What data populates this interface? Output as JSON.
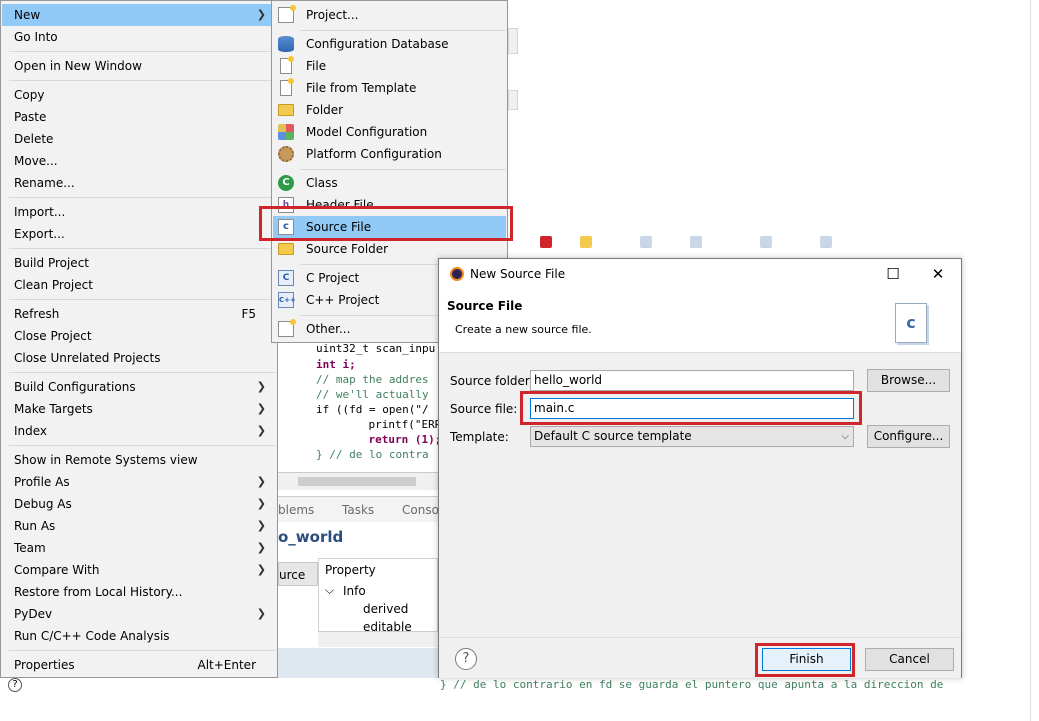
{
  "context_menu": {
    "items": [
      {
        "label": "New",
        "submenu": true,
        "highlighted": true
      },
      {
        "label": "Go Into"
      },
      {
        "label": "Open in New Window"
      },
      {
        "label": "Copy"
      },
      {
        "label": "Paste"
      },
      {
        "label": "Delete"
      },
      {
        "label": "Move..."
      },
      {
        "label": "Rename..."
      },
      {
        "label": "Import..."
      },
      {
        "label": "Export..."
      },
      {
        "label": "Build Project"
      },
      {
        "label": "Clean Project"
      },
      {
        "label": "Refresh",
        "accelerator": "F5"
      },
      {
        "label": "Close Project"
      },
      {
        "label": "Close Unrelated Projects"
      },
      {
        "label": "Build Configurations",
        "submenu": true
      },
      {
        "label": "Make Targets",
        "submenu": true
      },
      {
        "label": "Index",
        "submenu": true
      },
      {
        "label": "Show in Remote Systems view"
      },
      {
        "label": "Profile As",
        "submenu": true
      },
      {
        "label": "Debug As",
        "submenu": true
      },
      {
        "label": "Run As",
        "submenu": true
      },
      {
        "label": "Team",
        "submenu": true
      },
      {
        "label": "Compare With",
        "submenu": true
      },
      {
        "label": "Restore from Local History..."
      },
      {
        "label": "PyDev",
        "submenu": true
      },
      {
        "label": "Run C/C++ Code Analysis"
      },
      {
        "label": "Properties",
        "accelerator": "Alt+Enter"
      }
    ]
  },
  "new_submenu": {
    "items": [
      {
        "label": "Project...",
        "icon": "new-project-icon"
      },
      {
        "label": "Configuration Database",
        "icon": "database-icon"
      },
      {
        "label": "File",
        "icon": "file-icon"
      },
      {
        "label": "File from Template",
        "icon": "file-template-icon"
      },
      {
        "label": "Folder",
        "icon": "folder-icon"
      },
      {
        "label": "Model Configuration",
        "icon": "model-config-icon"
      },
      {
        "label": "Platform Configuration",
        "icon": "platform-config-icon"
      },
      {
        "label": "Class",
        "icon": "class-icon"
      },
      {
        "label": "Header File",
        "icon": "header-file-icon"
      },
      {
        "label": "Source File",
        "icon": "source-file-icon",
        "highlighted": true
      },
      {
        "label": "Source Folder",
        "icon": "source-folder-icon"
      },
      {
        "label": "C Project",
        "icon": "c-project-icon"
      },
      {
        "label": "C++ Project",
        "icon": "cpp-project-icon"
      },
      {
        "label": "Other...",
        "icon": "other-wizard-icon"
      }
    ]
  },
  "background_editor": {
    "code_lines": [
      "uint32_t scan_inpu",
      "int i;",
      "// map the addres",
      "// we'll actually",
      "if ((fd = open(\"/",
      "    printf(\"ERROR",
      "    return (1);",
      "} // de lo contra"
    ],
    "tabs": [
      "blems",
      "Tasks",
      "Conso"
    ],
    "properties_title": "o_world",
    "properties_source_col": "urce",
    "property_header": "Property",
    "property_group": "Info",
    "property_rows": [
      "derived",
      "editable"
    ],
    "bottom_line": "} // de lo contrario en fd se guarda el puntero que apunta a la direccion de"
  },
  "dialog": {
    "title": "New Source File",
    "header_title": "Source File",
    "header_description": "Create a new source file.",
    "source_folder_label": "Source folder:",
    "source_folder_value": "hello_world",
    "browse_label": "Browse...",
    "source_file_label": "Source file:",
    "source_file_value": "main.c",
    "template_label": "Template:",
    "template_value": "Default C source template",
    "configure_label": "Configure...",
    "finish_label": "Finish",
    "cancel_label": "Cancel",
    "help_symbol": "?"
  },
  "colors": {
    "highlight": "#91c9f7",
    "annotation_red": "#d0262b",
    "menu_bg": "#f2f2f2"
  }
}
